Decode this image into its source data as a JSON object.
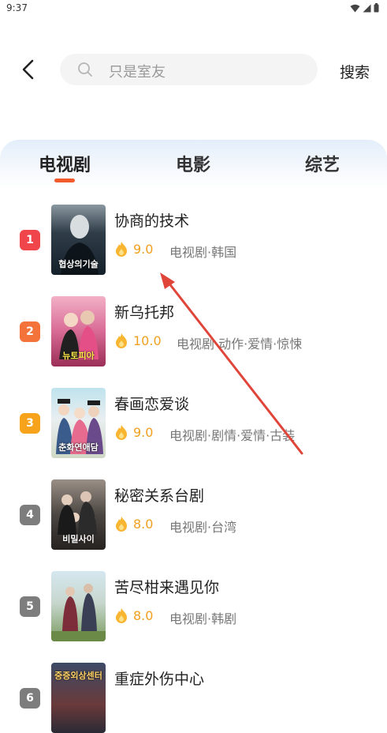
{
  "status_bar": {
    "time": "9:37"
  },
  "header": {
    "search_placeholder": "只是室友",
    "search_button": "搜索"
  },
  "tabs": [
    {
      "label": "电视剧",
      "active": true
    },
    {
      "label": "电影",
      "active": false
    },
    {
      "label": "综艺",
      "active": false
    }
  ],
  "items": [
    {
      "rank": "1",
      "rank_color": "#f0454a",
      "title": "协商的技术",
      "score": "9.0",
      "tags": "电视剧·韩国",
      "poster_caption": "협상의기술"
    },
    {
      "rank": "2",
      "rank_color": "#f3733a",
      "title": "新乌托邦",
      "score": "10.0",
      "tags": "电视剧·动作·爱情·惊悚",
      "poster_caption": "뉴토피아"
    },
    {
      "rank": "3",
      "rank_color": "#f7a21b",
      "title": "春画恋爱谈",
      "score": "9.0",
      "tags": "电视剧·剧情·爱情·古装",
      "poster_caption": "춘화연애담"
    },
    {
      "rank": "4",
      "rank_color": "#7d7d7d",
      "title": "秘密关系台剧",
      "score": "8.0",
      "tags": "电视剧·台湾",
      "poster_caption": "비밀사이"
    },
    {
      "rank": "5",
      "rank_color": "#7d7d7d",
      "title": "苦尽柑来遇见你",
      "score": "8.0",
      "tags": "电视剧·韩剧",
      "poster_caption": ""
    },
    {
      "rank": "6",
      "rank_color": "#7d7d7d",
      "title": "重症外伤中心",
      "score": "",
      "tags": "",
      "poster_caption": "중증외상센터"
    }
  ],
  "colors": {
    "accent": "#f25a2c",
    "score": "#f0a020",
    "annotation_arrow": "#e0453a"
  }
}
